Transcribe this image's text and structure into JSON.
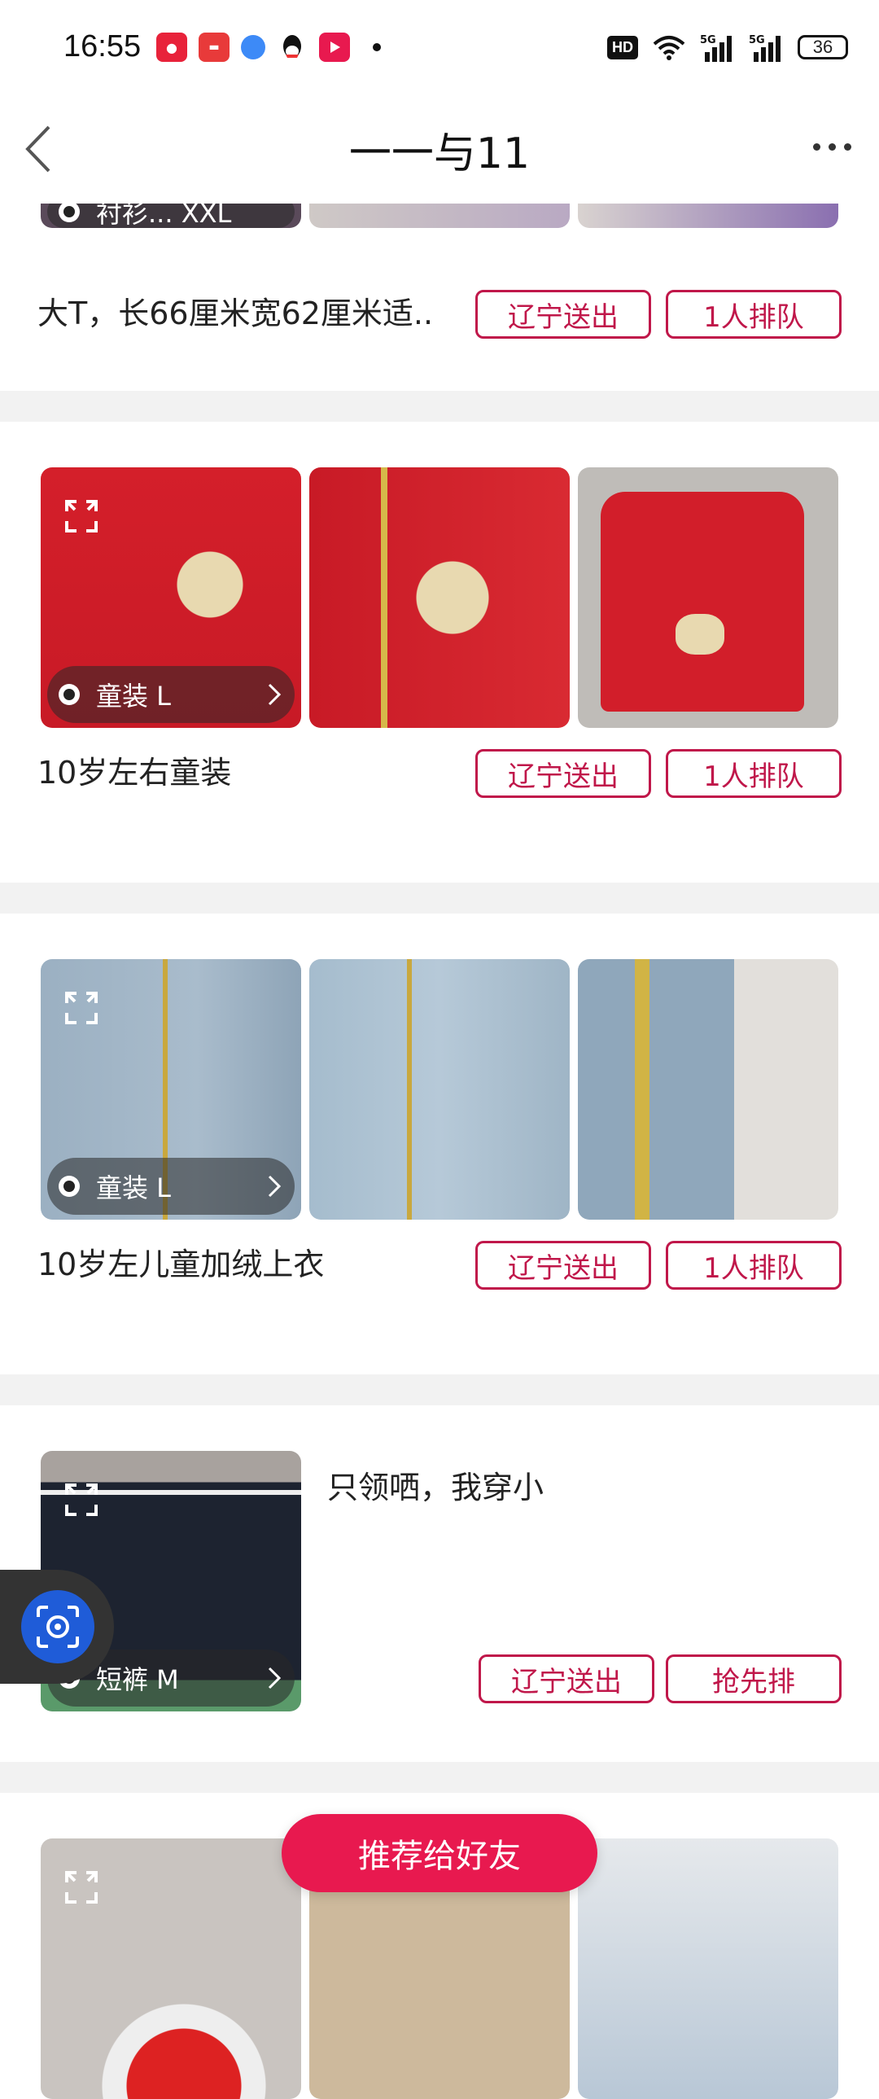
{
  "status_bar": {
    "time": "16:55",
    "hd_label": "HD",
    "battery": "36",
    "network": "5G"
  },
  "nav": {
    "title": "一一与11"
  },
  "listings": [
    {
      "tag": "衬衫... XXL",
      "description": "大T，长66厘米宽62厘米适..",
      "send_label": "辽宁送出",
      "queue_label": "1人排队"
    },
    {
      "tag": "童装 L",
      "description": "10岁左右童装",
      "send_label": "辽宁送出",
      "queue_label": "1人排队"
    },
    {
      "tag": "童装 L",
      "description": "10岁左儿童加绒上衣",
      "send_label": "辽宁送出",
      "queue_label": "1人排队"
    },
    {
      "tag": "短裤 M",
      "description": "只领哂，我穿小",
      "send_label": "辽宁送出",
      "queue_label": "抢先排"
    }
  ],
  "floating": {
    "recommend_label": "推荐给好友",
    "scan_icon": "camera-scan-icon"
  },
  "colors": {
    "accent": "#c0174a",
    "recommend_bg": "#e8194f",
    "divider": "#f2f2f2"
  },
  "icons": [
    "back-icon",
    "more-icon",
    "expand-icon",
    "chevron-right-icon",
    "camera-scan-icon"
  ]
}
